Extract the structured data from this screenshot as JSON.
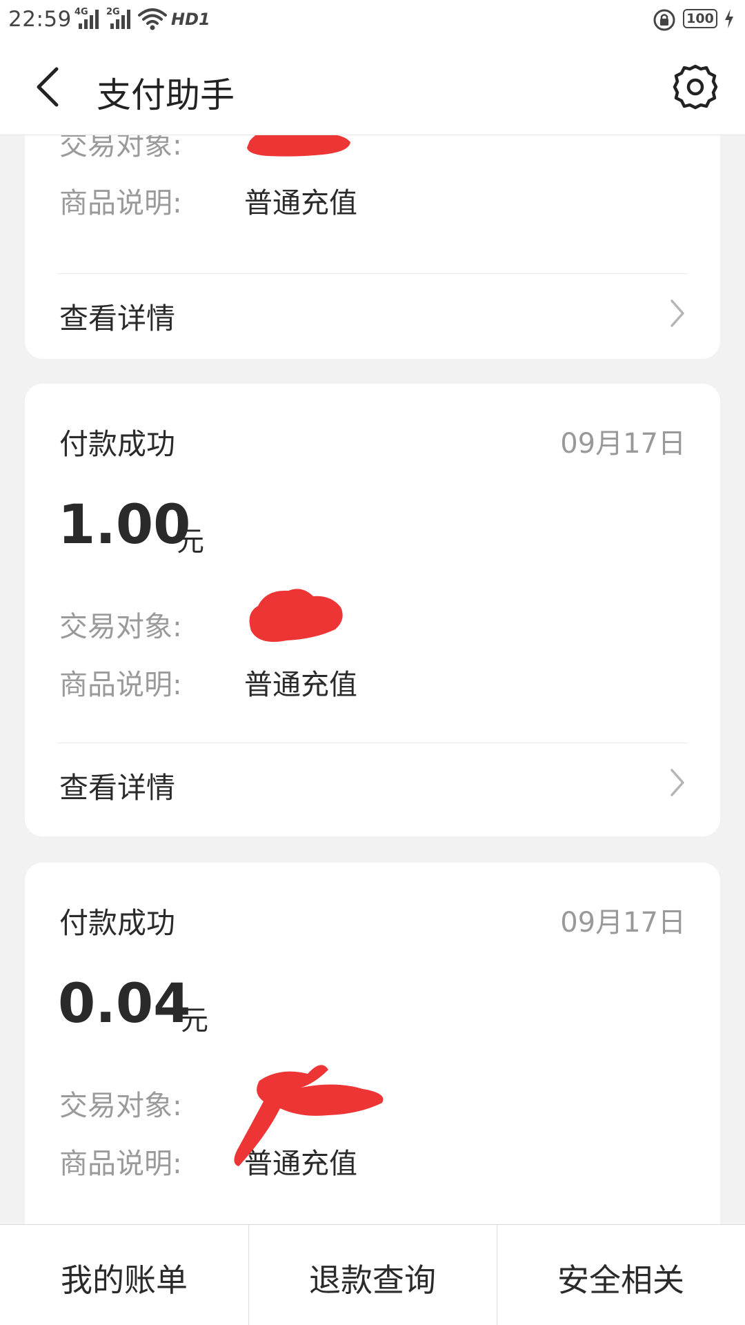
{
  "status_bar": {
    "time": "22:59",
    "signal_1_type": "4G",
    "signal_2_type": "2G",
    "hd_badge": "HD1",
    "battery_level": "100"
  },
  "header": {
    "title": "支付助手"
  },
  "cards": [
    {
      "counterparty_label": "交易对象:",
      "description_label": "商品说明:",
      "description_value": "普通充值",
      "details_label": "查看详情"
    },
    {
      "status": "付款成功",
      "date": "09月17日",
      "amount": "1.00",
      "unit": "元",
      "counterparty_label": "交易对象:",
      "description_label": "商品说明:",
      "description_value": "普通充值",
      "details_label": "查看详情"
    },
    {
      "status": "付款成功",
      "date": "09月17日",
      "amount": "0.04",
      "unit": "元",
      "counterparty_label": "交易对象:",
      "description_label": "商品说明:",
      "description_value": "普通充值"
    }
  ],
  "bottom_nav": {
    "items": [
      "我的账单",
      "退款查询",
      "安全相关"
    ]
  },
  "colors": {
    "redaction": "#ee3535",
    "muted_text": "#9a9a9a",
    "background": "#f2f2f2"
  },
  "icons": {
    "back": "back-arrow-icon",
    "settings": "gear-icon",
    "row_chevron": "chevron-right-icon",
    "menu": "menu-handle-icon"
  }
}
